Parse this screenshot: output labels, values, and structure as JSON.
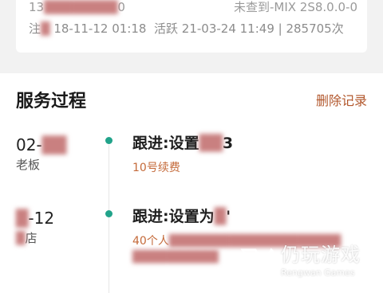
{
  "user_card": {
    "phone": "13",
    "phone_tail": "0",
    "device": "未查到-MIX 2S8.0.0-0",
    "reg_prefix": "注",
    "reg_date": "18-11-12 01:18",
    "active_label": "活跃",
    "active_date": "21-03-24 11:49 | 285705次"
  },
  "service": {
    "title": "服务过程",
    "delete_label": "删除记录",
    "entries": [
      {
        "date": "02-",
        "who": "老板",
        "title": "跟进:设置",
        "title_tail": "3",
        "sub": "10号续费",
        "sub2": ""
      },
      {
        "date": "-12",
        "who": "店",
        "title": "跟进:设置为",
        "title_tail": "'",
        "sub": "40个人",
        "sub2": ""
      }
    ]
  },
  "watermark": {
    "name": "仍玩游戏",
    "sub": "Rengwan Games"
  },
  "colors": {
    "accent": "#b2572c",
    "dot": "#21a38a",
    "sub_text": "#c46a3a"
  }
}
